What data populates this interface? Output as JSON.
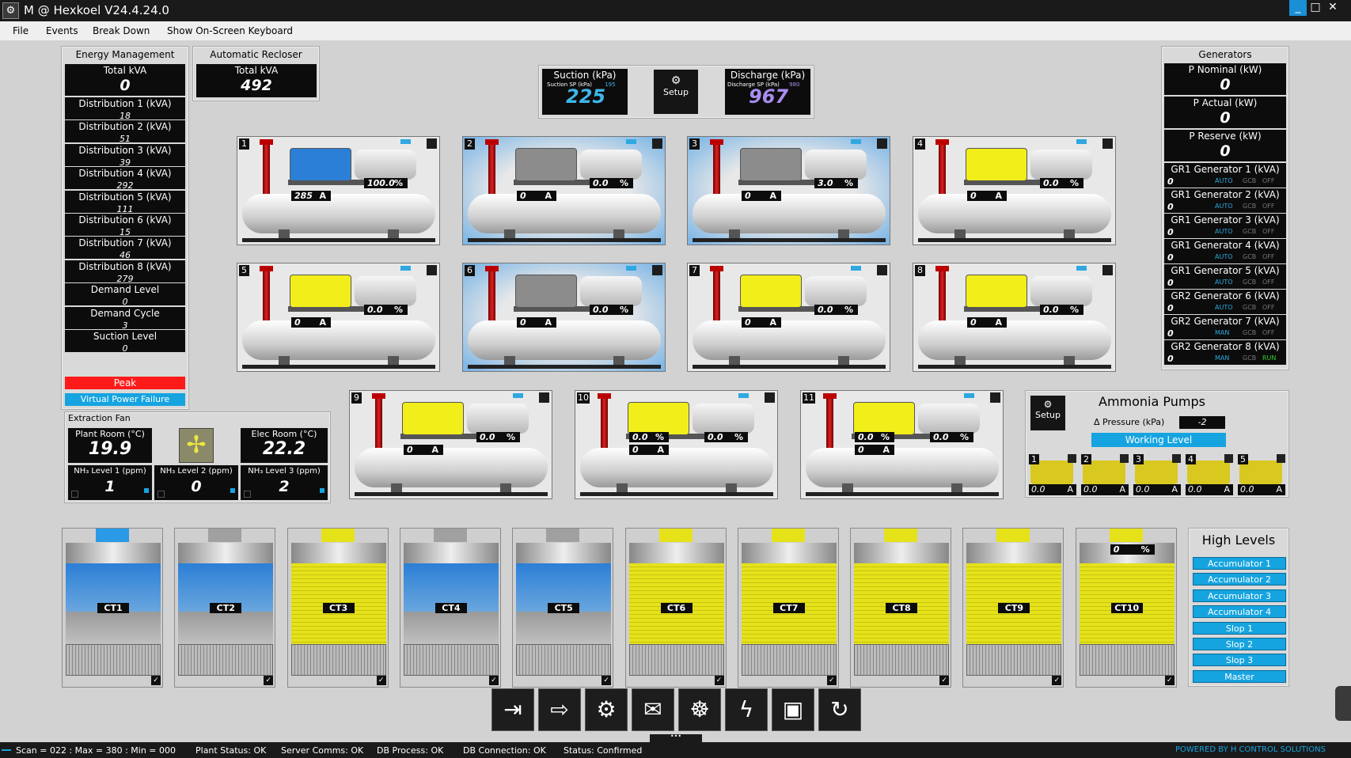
{
  "titlebar": {
    "title": "M @ Hexkoel V24.4.24.0",
    "logo_icon": "hexkoel-logo-icon"
  },
  "menu": {
    "file": "File",
    "events": "Events",
    "breakdown": "Break Down",
    "keyboard": "Show On-Screen Keyboard"
  },
  "energy": {
    "title": "Energy Management",
    "total_label": "Total kVA",
    "total_value": "0",
    "items": [
      {
        "label": "Distribution 1 (kVA)",
        "value": "18"
      },
      {
        "label": "Distribution 2 (kVA)",
        "value": "51"
      },
      {
        "label": "Distribution 3 (kVA)",
        "value": "39"
      },
      {
        "label": "Distribution 4 (kVA)",
        "value": "292"
      },
      {
        "label": "Distribution 5 (kVA)",
        "value": "111"
      },
      {
        "label": "Distribution 6 (kVA)",
        "value": "15"
      },
      {
        "label": "Distribution 7 (kVA)",
        "value": "46"
      },
      {
        "label": "Distribution 8 (kVA)",
        "value": "279"
      },
      {
        "label": "Demand Level",
        "value": "0"
      },
      {
        "label": "Demand Cycle",
        "value": "3"
      },
      {
        "label": "Suction Level",
        "value": "0"
      }
    ],
    "peak": "Peak",
    "vpf": "Virtual Power Failure"
  },
  "recloser": {
    "title": "Automatic Recloser",
    "label": "Total kVA",
    "value": "492"
  },
  "suction": {
    "title": "Suction (kPa)",
    "sp_label": "Suction SP (kPa)",
    "sp": "195",
    "value": "225"
  },
  "discharge": {
    "title": "Discharge (kPa)",
    "sp_label": "Discharge SP (kPa)",
    "sp": "980",
    "value": "967"
  },
  "setup_label": "Setup",
  "compressors": [
    {
      "n": "1",
      "pct": "100.0",
      "amps": "285",
      "motor": "blue"
    },
    {
      "n": "2",
      "pct": "0.0",
      "amps": "0",
      "motor": "grey"
    },
    {
      "n": "3",
      "pct": "3.0",
      "amps": "0",
      "motor": "grey"
    },
    {
      "n": "4",
      "pct": "0.0",
      "amps": "0",
      "motor": "yellow"
    },
    {
      "n": "5",
      "pct": "0.0",
      "amps": "0",
      "motor": "yellow"
    },
    {
      "n": "6",
      "pct": "0.0",
      "amps": "0",
      "motor": "grey"
    },
    {
      "n": "7",
      "pct": "0.0",
      "amps": "0",
      "motor": "yellow"
    },
    {
      "n": "8",
      "pct": "0.0",
      "amps": "0",
      "motor": "yellow"
    },
    {
      "n": "9",
      "pct": "0.0",
      "amps": "0",
      "motor": "yellow"
    },
    {
      "n": "10",
      "pct": "0.0",
      "amps": "0",
      "motor": "yellow",
      "pct2": "0.0"
    },
    {
      "n": "11",
      "pct": "0.0",
      "amps": "0",
      "motor": "yellow",
      "pct2": "0.0"
    }
  ],
  "pct_unit": "%",
  "amp_unit": "A",
  "generators": {
    "title": "Generators",
    "nominal_label": "P Nominal (kW)",
    "nominal": "0",
    "actual_label": "P Actual (kW)",
    "actual": "0",
    "reserve_label": "P Reserve (kW)",
    "reserve": "0",
    "items": [
      {
        "label": "GR1 Generator 1 (kVA)",
        "value": "0",
        "mode": "AUTO",
        "gcb": "GCB",
        "state": "OFF"
      },
      {
        "label": "GR1 Generator 2 (kVA)",
        "value": "0",
        "mode": "AUTO",
        "gcb": "GCB",
        "state": "OFF"
      },
      {
        "label": "GR1 Generator 3 (kVA)",
        "value": "0",
        "mode": "AUTO",
        "gcb": "GCB",
        "state": "OFF"
      },
      {
        "label": "GR1 Generator 4 (kVA)",
        "value": "0",
        "mode": "AUTO",
        "gcb": "GCB",
        "state": "OFF"
      },
      {
        "label": "GR1 Generator 5 (kVA)",
        "value": "0",
        "mode": "AUTO",
        "gcb": "GCB",
        "state": "OFF"
      },
      {
        "label": "GR2 Generator 6 (kVA)",
        "value": "0",
        "mode": "AUTO",
        "gcb": "GCB",
        "state": "OFF"
      },
      {
        "label": "GR2 Generator 7 (kVA)",
        "value": "0",
        "mode": "MAN",
        "gcb": "GCB",
        "state": "OFF"
      },
      {
        "label": "GR2 Generator 8 (kVA)",
        "value": "0",
        "mode": "MAN",
        "gcb": "GCB",
        "state": "RUN"
      }
    ]
  },
  "extraction": {
    "title": "Extraction Fan",
    "plant_label": "Plant Room (°C)",
    "plant": "19.9",
    "elec_label": "Elec Room (°C)",
    "elec": "22.2",
    "nh3": [
      {
        "label": "NH₃ Level 1 (ppm)",
        "value": "1"
      },
      {
        "label": "NH₃ Level 2 (ppm)",
        "value": "0"
      },
      {
        "label": "NH₃ Level 3 (ppm)",
        "value": "2"
      }
    ]
  },
  "ammonia": {
    "title": "Ammonia Pumps",
    "dp_label": "Δ Pressure (kPa)",
    "dp": "-2",
    "working": "Working Level",
    "pumps": [
      {
        "n": "1",
        "v": "0.0"
      },
      {
        "n": "2",
        "v": "0.0"
      },
      {
        "n": "3",
        "v": "0.0"
      },
      {
        "n": "4",
        "v": "0.0"
      },
      {
        "n": "5",
        "v": "0.0"
      }
    ]
  },
  "cooling_towers": [
    {
      "label": "CT1",
      "color": "blue"
    },
    {
      "label": "CT2",
      "color": "blue"
    },
    {
      "label": "CT3",
      "color": "yellow"
    },
    {
      "label": "CT4",
      "color": "blue"
    },
    {
      "label": "CT5",
      "color": "blue"
    },
    {
      "label": "CT6",
      "color": "yellow"
    },
    {
      "label": "CT7",
      "color": "yellow"
    },
    {
      "label": "CT8",
      "color": "yellow"
    },
    {
      "label": "CT9",
      "color": "yellow"
    },
    {
      "label": "CT10",
      "color": "yellow",
      "pct": "0"
    }
  ],
  "high_levels": {
    "title": "High Levels",
    "items": [
      "Accumulator 1",
      "Accumulator 2",
      "Accumulator 3",
      "Accumulator 4",
      "Slop 1",
      "Slop 2",
      "Slop 3",
      "Master"
    ]
  },
  "toolbar": [
    "login-icon",
    "logout-icon",
    "users-settings-icon",
    "mail-icon",
    "gear-tree-icon",
    "power-icon",
    "save-icon",
    "refresh-icon"
  ],
  "status": {
    "scan": "Scan = 022 : Max = 380 : Min = 000",
    "plant": "Plant Status: OK",
    "server": "Server Comms: OK",
    "dbproc": "DB Process:  OK",
    "dbconn": "DB Connection:  OK",
    "state": "Status:  Confirmed",
    "powered": "POWERED BY H CONTROL SOLUTIONS"
  },
  "colors": {
    "blue": "#2b7fd6",
    "grey": "#8c8c8c",
    "yellow": "#f2ee1a",
    "accent": "#16a4e0",
    "peak": "#ff1a1a",
    "suction": "#3fb6ea",
    "discharge": "#a88df0"
  }
}
